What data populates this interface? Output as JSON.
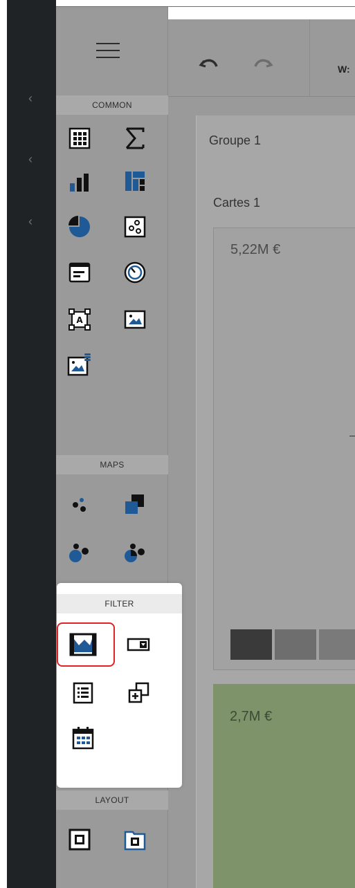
{
  "toolbox": {
    "sections": {
      "common": "COMMON",
      "maps": "MAPS",
      "filter": "FILTER",
      "layout": "LAYOUT"
    },
    "icons": {
      "menu": "hamburger-menu-icon",
      "grid": "grid-icon",
      "sum": "sigma-icon",
      "bar_chart": "bar-chart-icon",
      "treemap": "treemap-icon",
      "pie": "pie-chart-icon",
      "scatter": "scatter-icon",
      "card": "card-icon",
      "gauge": "gauge-icon",
      "text_box": "text-box-icon",
      "image": "image-icon",
      "bound_image": "bound-image-icon",
      "geo_points": "geo-point-map-icon",
      "choropleth": "choropleth-map-icon",
      "bubble_map": "bubble-map-icon",
      "pie_map": "pie-map-icon",
      "range_filter": "range-filter-icon",
      "combo_box": "combo-box-icon",
      "list_box": "list-box-icon",
      "tree_view": "tree-view-icon",
      "date_filter": "date-filter-icon",
      "group_layout": "group-icon",
      "tab_container": "tab-container-icon"
    }
  },
  "toolbar": {
    "ws_label": "W:"
  },
  "canvas": {
    "group_title": "Groupe 1",
    "cards_title": "Cartes 1",
    "card1_value": "5,22M €",
    "card2_value": "2,7M €"
  },
  "colors": {
    "accent_blue": "#1f5a96",
    "selection_red": "#e02222",
    "card_green": "#7e936a",
    "rail_dark": "#1f2326"
  }
}
